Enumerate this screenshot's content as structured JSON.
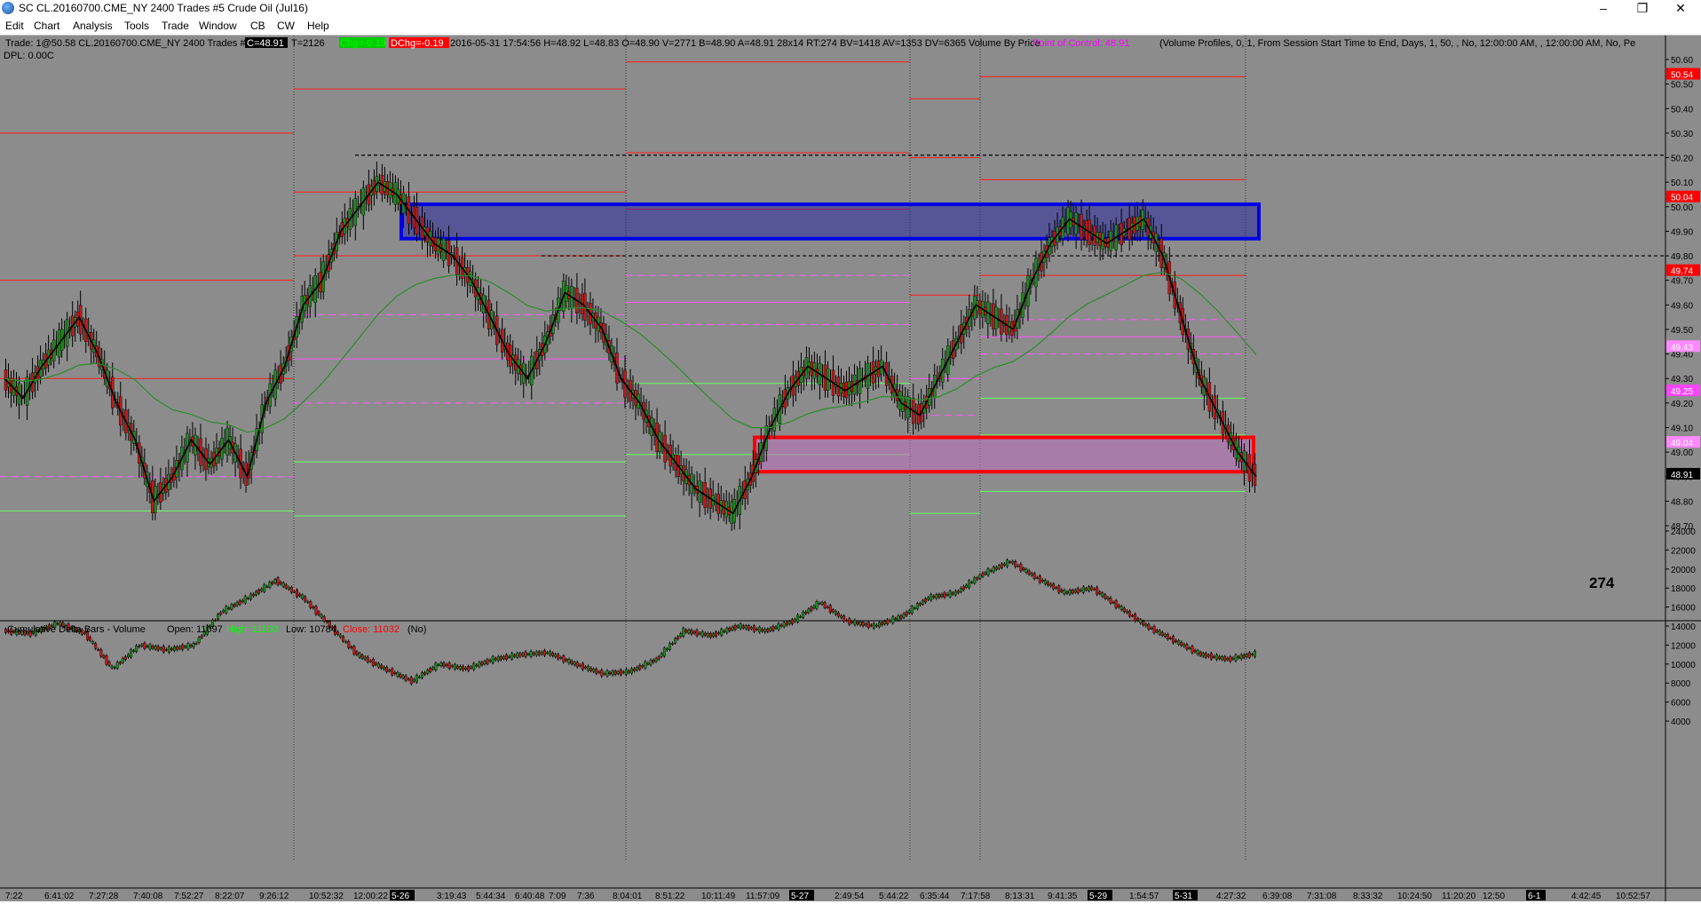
{
  "window": {
    "title": "SC CL.20160700.CME_NY  2400 Trades  #5  Crude Oil (Jul16)",
    "minimize_icon": "minimize-icon",
    "maximize_icon": "restore-icon",
    "close_icon": "close-icon"
  },
  "menu": [
    "Edit",
    "Chart",
    "Analysis",
    "Tools",
    "Trade",
    "Window",
    "CB",
    "CW",
    "Help"
  ],
  "price_panel": {
    "header_prefix": "Trade: 1@50.58  CL.20160700.CME_NY  2400 Trades  #5",
    "c_value": "C=48.91",
    "t_value": "T=2126",
    "chg_value": "Chg=-0.19",
    "dchg_value": "DChg=-0.19",
    "header_middle": "2016-05-31  17:54:56  H=48.92  L=48.83  O=48.90  V=2771  B=48.90  A=48.91  28x14  RT:274  BV=1418  AV=1353  DV=6365  Volume By Price",
    "poc_label": "Point of Control: 48.91",
    "header_suffix": "(Volume Profiles, 0, 1, From Session Start Time to End, Days, 1, 50, , No, 12:00:00 AM, , 12:00:00 AM, No, Pe",
    "dpl": "DPL: 0.00C",
    "bar_counter": "274"
  },
  "delta_panel": {
    "label": "Cumulative Delta Bars - Volume",
    "open": "Open: 11097",
    "high": "High: 11100",
    "low": "Low: 10784",
    "close": "Close: 11032",
    "extra": "(No)"
  },
  "colors": {
    "background": "#8c8c8c",
    "grid": "#a8a8a8",
    "red_level": "#ff1a1a",
    "green_level": "#66ff66",
    "magenta_level": "#ff55ff",
    "blue_zone": "#2a2aa0",
    "blue_zone_border": "#0000e6",
    "pink_zone": "#c070c0",
    "pink_zone_border": "#ff0000",
    "ma_fast": "#000000",
    "ma_slow": "#2e8b2e"
  },
  "chart_data": [
    {
      "type": "candlestick",
      "title": "Crude Oil (Jul16)",
      "ylim": [
        48.66,
        50.62
      ],
      "y_ticks": [
        "50.60",
        "50.50",
        "50.40",
        "50.30",
        "50.20",
        "50.10",
        "50.00",
        "49.90",
        "49.80",
        "49.70",
        "49.60",
        "49.50",
        "49.40",
        "49.30",
        "49.20",
        "49.10",
        "49.00",
        "48.90",
        "48.80",
        "48.70"
      ],
      "x_tick_labels": [
        "7:22",
        "6:41:02",
        "7:27:28",
        "7:40:08",
        "7:52:27",
        "8:22:07",
        "9:26:12",
        "10:52:32",
        "12:00:22",
        "5-26",
        "3:19:43",
        "5:44:34",
        "6:40:48",
        "7:09",
        "7:36",
        "8:04:01",
        "8:51:22",
        "10:11:49",
        "11:57:09",
        "5-27",
        "2:49:54",
        "5:44:22",
        "6:35:44",
        "7:17:58",
        "8:13:31",
        "9:41:35",
        "5-29",
        "1:54:57",
        "5-31",
        "4:27:32",
        "6:39:08",
        "7:31:08",
        "8:33:32",
        "10:24:50",
        "11:20:20",
        "12:50",
        "6-1",
        "4:42:45",
        "10:52:57"
      ],
      "price_labels": [
        {
          "value": "50.54",
          "color": "#ff0000"
        },
        {
          "value": "50.04",
          "color": "#ff0000"
        },
        {
          "value": "49.74",
          "color": "#ff0000"
        },
        {
          "value": "49.43",
          "color": "#ff88ff"
        },
        {
          "value": "49.25",
          "color": "#ff44ff"
        },
        {
          "value": "49.04",
          "color": "#ff88ff"
        },
        {
          "value": "48.91",
          "color": "#000000"
        }
      ],
      "reference_lines": [
        {
          "value": 50.21,
          "style": "dashed",
          "color": "#000000"
        },
        {
          "value": 49.8,
          "style": "dashed",
          "color": "#000000"
        }
      ],
      "zones": [
        {
          "name": "resistance",
          "from": 49.87,
          "to": 50.01,
          "color": "#0000e6"
        },
        {
          "name": "support",
          "from": 48.92,
          "to": 49.06,
          "color": "#ff0000"
        }
      ],
      "sessions": [
        "5-26",
        "5-27",
        "5-29",
        "5-31"
      ],
      "series": [
        {
          "name": "",
          "kind": "close_path",
          "values": [
            49.3,
            49.22,
            49.35,
            49.45,
            49.55,
            49.4,
            49.2,
            49.05,
            48.8,
            48.9,
            49.05,
            48.95,
            49.05,
            48.9,
            49.2,
            49.35,
            49.6,
            49.7,
            49.9,
            50.0,
            50.1,
            50.05,
            49.95,
            49.85,
            49.8,
            49.7,
            49.55,
            49.4,
            49.3,
            49.45,
            49.65,
            49.6,
            49.5,
            49.3,
            49.2,
            49.05,
            48.95,
            48.85,
            48.8,
            48.75,
            48.9,
            49.1,
            49.25,
            49.35,
            49.3,
            49.25,
            49.3,
            49.35,
            49.2,
            49.15,
            49.3,
            49.45,
            49.6,
            49.55,
            49.5,
            49.7,
            49.85,
            49.95,
            49.9,
            49.85,
            49.9,
            49.95,
            49.8,
            49.55,
            49.3,
            49.15,
            49.0,
            48.9
          ]
        }
      ],
      "ohlc": []
    },
    {
      "type": "bar",
      "title": "Cumulative Delta Bars - Volume",
      "ylim": [
        4000,
        25000
      ],
      "y_ticks": [
        "24000",
        "22000",
        "20000",
        "18000",
        "16000",
        "14000",
        "12000",
        "10000",
        "8000",
        "6000",
        "4000"
      ],
      "series": [
        {
          "name": "",
          "values": [
            13500,
            13200,
            14300,
            13200,
            9500,
            12000,
            11500,
            12000,
            15500,
            17000,
            18800,
            17000,
            14000,
            11000,
            9500,
            8200,
            10000,
            9500,
            10500,
            11000,
            11200,
            10000,
            9000,
            9200,
            10500,
            13500,
            13000,
            14000,
            13500,
            14500,
            16500,
            14500,
            14000,
            15000,
            17000,
            17500,
            19500,
            20800,
            19000,
            17500,
            18000,
            16000,
            14000,
            12500,
            11000,
            10500,
            11100
          ]
        }
      ]
    }
  ]
}
